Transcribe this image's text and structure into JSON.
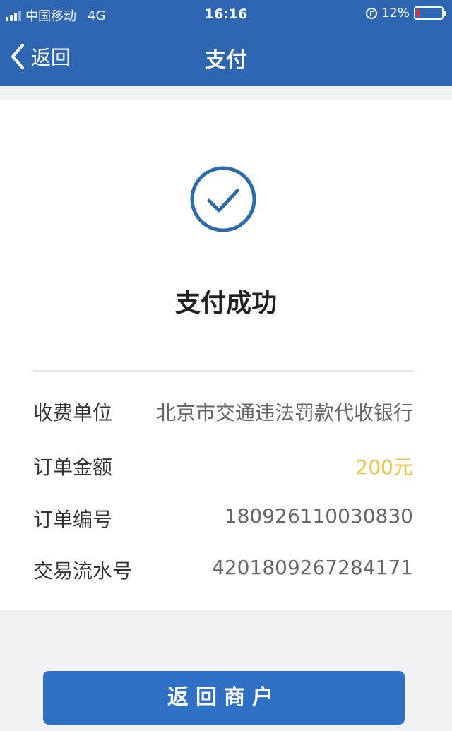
{
  "status_bar": {
    "carrier": "中国移动",
    "network": "4G",
    "time": "16:16",
    "battery_percent": "12%",
    "battery_level": 0.12,
    "battery_color": "#e03030"
  },
  "nav": {
    "back_label": "返回",
    "title": "支付",
    "background_color": "#2e66b1"
  },
  "result": {
    "icon": "check-circle-icon",
    "title": "支付成功"
  },
  "details": [
    {
      "label": "收费单位",
      "value": "北京市交通违法罚款代收银行"
    },
    {
      "label": "订单金额",
      "value": "200元"
    },
    {
      "label": "订单编号",
      "value": "180926110030830"
    },
    {
      "label": "交易流水号",
      "value": "4201809267284171"
    }
  ],
  "colors": {
    "accent": "#2f6fc4",
    "amount": "#e3c64f"
  },
  "actions": {
    "return_label": "返回商户"
  }
}
